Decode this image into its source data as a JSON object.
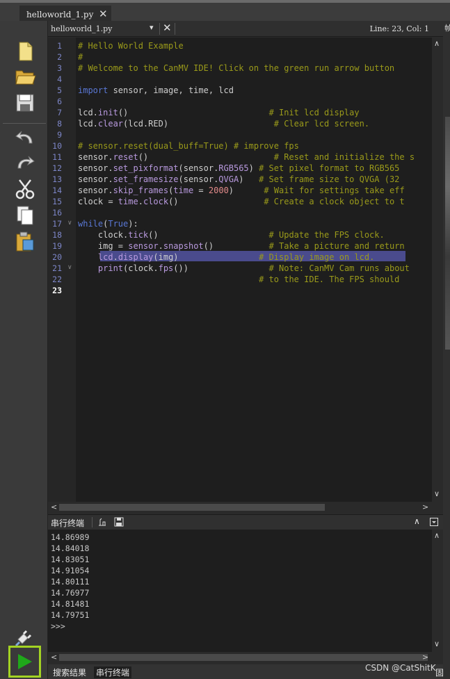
{
  "top_tab": {
    "label": "helloworld_1.py",
    "close": "✕"
  },
  "editor_header": {
    "file": "helloworld_1.py",
    "dropdown": "▾",
    "close": "✕",
    "position": "Line: 23, Col: 1",
    "right_clip": "帧"
  },
  "code": {
    "line_numbers": [
      "1",
      "2",
      "3",
      "4",
      "5",
      "6",
      "7",
      "8",
      "9",
      "10",
      "11",
      "12",
      "13",
      "14",
      "15",
      "16",
      "17",
      "18",
      "19",
      "20",
      "21",
      "22",
      "23"
    ],
    "lines": [
      [
        [
          "c-cm",
          "# Hello World Example"
        ]
      ],
      [
        [
          "c-cm",
          "#"
        ]
      ],
      [
        [
          "c-cm",
          "# Welcome to the CanMV IDE! Click on the green run arrow button"
        ]
      ],
      [],
      [
        [
          "c-kw",
          "import"
        ],
        [
          "c-id",
          " sensor, image, time, lcd"
        ]
      ],
      [],
      [
        [
          "c-id",
          "lcd."
        ],
        [
          "c-fn",
          "init"
        ],
        [
          "c-id",
          "()                            "
        ],
        [
          "c-cm",
          "# Init lcd display"
        ]
      ],
      [
        [
          "c-id",
          "lcd."
        ],
        [
          "c-fn",
          "clear"
        ],
        [
          "c-id",
          "(lcd.RED)                     "
        ],
        [
          "c-cm",
          "# Clear lcd screen."
        ]
      ],
      [],
      [
        [
          "c-cm",
          "# sensor.reset(dual_buff=True) # improve fps"
        ]
      ],
      [
        [
          "c-id",
          "sensor."
        ],
        [
          "c-fn",
          "reset"
        ],
        [
          "c-id",
          "()                         "
        ],
        [
          "c-cm",
          "# Reset and initialize the s"
        ]
      ],
      [
        [
          "c-id",
          "sensor."
        ],
        [
          "c-fn",
          "set_pixformat"
        ],
        [
          "c-id",
          "(sensor."
        ],
        [
          "c-fn",
          "RGB565"
        ],
        [
          "c-id",
          ") "
        ],
        [
          "c-cm",
          "# Set pixel format to RGB565"
        ]
      ],
      [
        [
          "c-id",
          "sensor."
        ],
        [
          "c-fn",
          "set_framesize"
        ],
        [
          "c-id",
          "(sensor."
        ],
        [
          "c-fn",
          "QVGA"
        ],
        [
          "c-id",
          ")   "
        ],
        [
          "c-cm",
          "# Set frame size to QVGA (32"
        ]
      ],
      [
        [
          "c-id",
          "sensor."
        ],
        [
          "c-fn",
          "skip_frames"
        ],
        [
          "c-id",
          "("
        ],
        [
          "c-fn",
          "time"
        ],
        [
          "c-id",
          " = "
        ],
        [
          "c-num",
          "2000"
        ],
        [
          "c-id",
          ")      "
        ],
        [
          "c-cm",
          "# Wait for settings take eff"
        ]
      ],
      [
        [
          "c-id",
          "clock = "
        ],
        [
          "c-fn",
          "time"
        ],
        [
          "c-id",
          "."
        ],
        [
          "c-fn",
          "clock"
        ],
        [
          "c-id",
          "()                 "
        ],
        [
          "c-cm",
          "# Create a clock object to t"
        ]
      ],
      [],
      [
        [
          "c-kw",
          "while"
        ],
        [
          "c-id",
          "("
        ],
        [
          "c-kw",
          "True"
        ],
        [
          "c-id",
          "):"
        ]
      ],
      [
        [
          "c-id",
          "    clock."
        ],
        [
          "c-fn",
          "tick"
        ],
        [
          "c-id",
          "()                      "
        ],
        [
          "c-cm",
          "# Update the FPS clock."
        ]
      ],
      [
        [
          "c-id",
          "    img = "
        ],
        [
          "c-fn",
          "sensor"
        ],
        [
          "c-id",
          "."
        ],
        [
          "c-fn",
          "snapshot"
        ],
        [
          "c-id",
          "()           "
        ],
        [
          "c-cm",
          "# Take a picture and return"
        ]
      ],
      [
        [
          "c-id",
          "    "
        ],
        [
          "c-fn",
          "lcd"
        ],
        [
          "c-id",
          "."
        ],
        [
          "c-fn",
          "display"
        ],
        [
          "c-id",
          "(img)                "
        ],
        [
          "c-cm",
          "# Display image on lcd."
        ]
      ],
      [
        [
          "c-id",
          "    "
        ],
        [
          "c-fn",
          "print"
        ],
        [
          "c-id",
          "(clock."
        ],
        [
          "c-fn",
          "fps"
        ],
        [
          "c-id",
          "())                "
        ],
        [
          "c-cm",
          "# Note: CanMV Cam runs about"
        ]
      ],
      [
        [
          "c-id",
          "                                    "
        ],
        [
          "c-cm",
          "# to the IDE. The FPS should"
        ]
      ],
      []
    ]
  },
  "terminal": {
    "title": "串行终端",
    "lines": [
      "14.86989",
      "14.84018",
      "14.83051",
      "14.91054",
      "14.80111",
      "14.76977",
      "14.81481",
      "14.79751",
      ">>>"
    ]
  },
  "bottom_tabs": [
    "搜索结果",
    "串行终端"
  ],
  "right_edge_text": "固件",
  "watermark": "CSDN @CatShitK",
  "colors": {
    "run_highlight": "#a3d323",
    "run_arrow": "#1fa81a",
    "line_highlight": "#4a4b8d"
  }
}
